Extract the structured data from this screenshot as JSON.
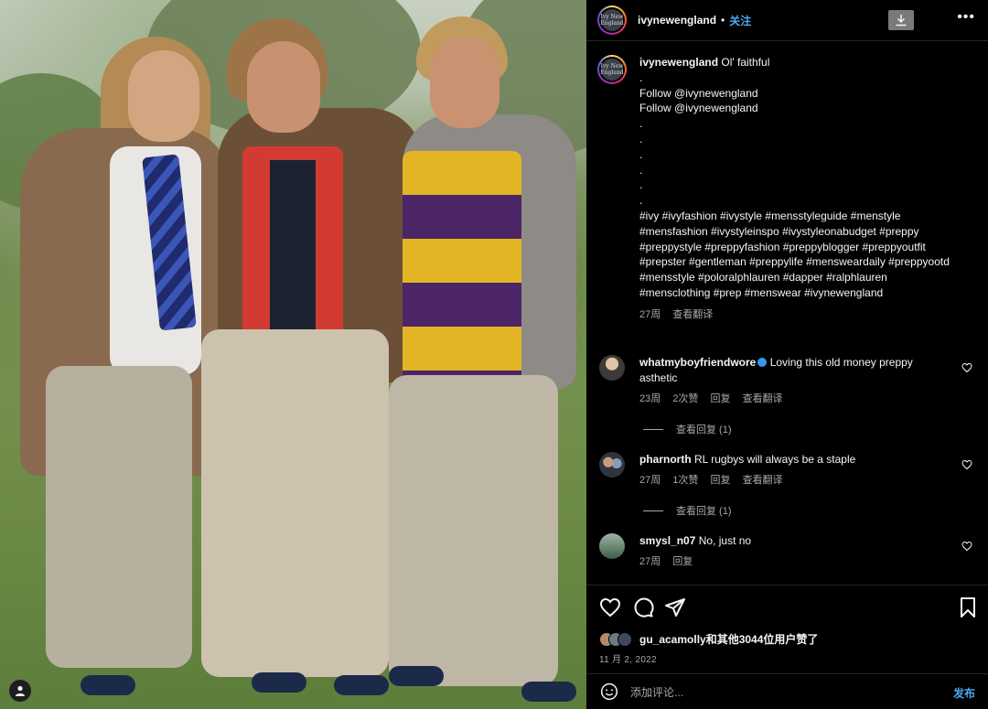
{
  "post": {
    "username": "ivynewengland",
    "follow_label": "关注",
    "avatar_text": "Ivy New England"
  },
  "caption": {
    "username": "ivynewengland",
    "lines": [
      "Ol' faithful",
      ".",
      "",
      "Follow @ivynewengland",
      "Follow @ivynewengland",
      ".",
      ".",
      ".",
      ".",
      ".",
      ".",
      "#ivy #ivyfashion #ivystyle #mensstyleguide #menstyle",
      "#mensfashion #ivystyleinspo #ivystyleonabudget #preppy",
      "#preppystyle #preppyfashion #preppyblogger #preppyoutfit",
      "#prepster #gentleman #preppylife #mensweardaily #preppyootd",
      "#mensstyle #poloralphlauren #dapper #ralphlauren",
      "#mensclothing #prep #menswear #ivynewengland"
    ],
    "time": "27周",
    "see_translation": "查看翻译"
  },
  "comments": [
    {
      "username": "whatmyboyfriendwore",
      "verified": true,
      "text_line1": "Loving this old money preppy",
      "text_line2": "asthetic",
      "time": "23周",
      "likes": "2次赞",
      "reply": "回复",
      "see_translation": "查看翻译",
      "view_replies": "查看回复 (1)"
    },
    {
      "username": "pharnorth",
      "text_line1": "RL rugbys will always be a staple",
      "time": "27周",
      "likes": "1次赞",
      "reply": "回复",
      "see_translation": "查看翻译",
      "view_replies": "查看回复 (1)"
    },
    {
      "username": "smysl_n07",
      "text_line1": "No, just no",
      "time": "27周",
      "reply": "回复"
    }
  ],
  "likes_summary": "gu_acamolly和其他3044位用户赞了",
  "date": "11 月 2, 2022",
  "add_comment": {
    "placeholder": "添加评论...",
    "post_label": "发布"
  },
  "icons": {
    "download": "download-icon",
    "more": "more-options-icon",
    "heart": "heart-icon",
    "comment": "comment-icon",
    "share": "share-icon",
    "save": "bookmark-icon",
    "emoji": "emoji-icon",
    "user_tag": "user-tag-icon"
  },
  "colors": {
    "accent": "#4fa6f0",
    "background": "#000000",
    "muted": "#a8a8a8"
  }
}
